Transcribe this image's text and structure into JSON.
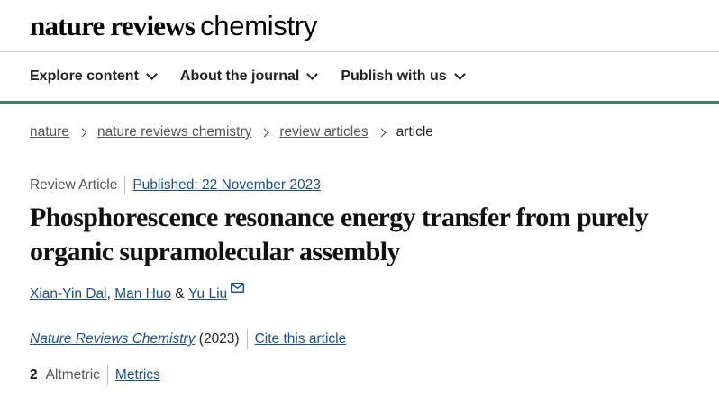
{
  "header": {
    "logo_bold": "nature reviews",
    "logo_light": "chemistry"
  },
  "nav": {
    "items": [
      {
        "label": "Explore content"
      },
      {
        "label": "About the journal"
      },
      {
        "label": "Publish with us"
      }
    ]
  },
  "breadcrumb": {
    "items": [
      "nature",
      "nature reviews chemistry",
      "review articles"
    ],
    "current": "article"
  },
  "article": {
    "type": "Review Article",
    "published": "Published: 22 November 2023",
    "title": "Phosphorescence resonance energy transfer from purely organic supramolecular assembly",
    "authors": [
      "Xian-Yin Dai",
      "Man Huo",
      "Yu Liu"
    ],
    "author_sep_comma": ",",
    "author_sep_amp": "&",
    "journal": "Nature Reviews Chemistry",
    "year": "(2023)",
    "cite_label": "Cite this article",
    "altmetric_score": "2",
    "altmetric_label": "Altmetric",
    "metrics_label": "Metrics"
  },
  "colors": {
    "accent_bar": "#3e7f5f",
    "link": "#1a4f8f"
  },
  "icons": [
    "chevron-down-icon",
    "chevron-right-icon",
    "mail-icon"
  ]
}
